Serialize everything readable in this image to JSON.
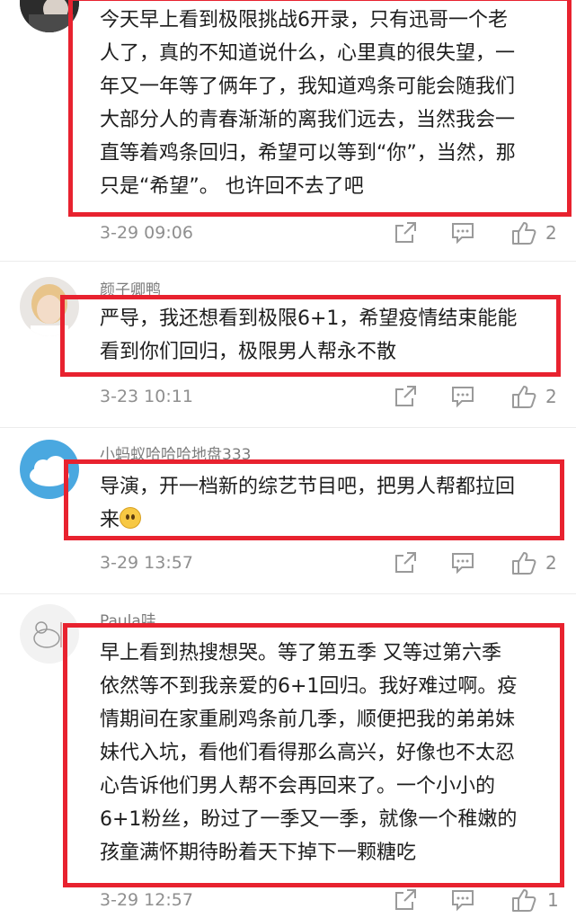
{
  "colors": {
    "highlight_box": "#e8222f",
    "meta_text": "#8f8f8f"
  },
  "comments": [
    {
      "username": "",
      "avatar_icon": "avatar-dark-icon",
      "text": "今天早上看到极限挑战6开录，只有迅哥一个老\n人了，真的不知道说什么，心里真的很失望，一\n年又一年等了俩年了，我知道鸡条可能会随我们\n大部分人的青春渐渐的离我们远去，当然我会一\n直等着鸡条回归，希望可以等到“你”，当然，那\n只是“希望”。 也许回不去了吧",
      "time": "3-29 09:06",
      "likes": "2"
    },
    {
      "username": "颜子卿鸭",
      "avatar_icon": "avatar-person-icon",
      "text": "严导，我还想看到极限6+1，希望疫情结束能能\n看到你们回归，极限男人帮永不散",
      "time": "3-23 10:11",
      "likes": "2"
    },
    {
      "username": "小蚂蚁哈哈哈地盘333",
      "avatar_icon": "avatar-cloud-icon",
      "text": "导演，开一档新的综艺节目吧，把男人帮都拉回\n来",
      "emoji": "pleading-face-emoji",
      "time": "3-29 13:57",
      "likes": "2"
    },
    {
      "username": "Paula哇",
      "avatar_icon": "avatar-sketch-icon",
      "text": "早上看到热搜想哭。等了第五季 又等过第六季\n依然等不到我亲爱的6+1回归。我好难过啊。疫\n情期间在家重刷鸡条前几季，顺便把我的弟弟妹\n妹代入坑，看他们看得那么高兴，好像也不太忍\n心告诉他们男人帮不会再回来了。一个小小的\n6+1粉丝，盼过了一季又一季，就像一个稚嫩的\n孩童满怀期待盼着天下掉下一颗糖吃",
      "time": "3-29 12:57",
      "likes": "1"
    }
  ]
}
